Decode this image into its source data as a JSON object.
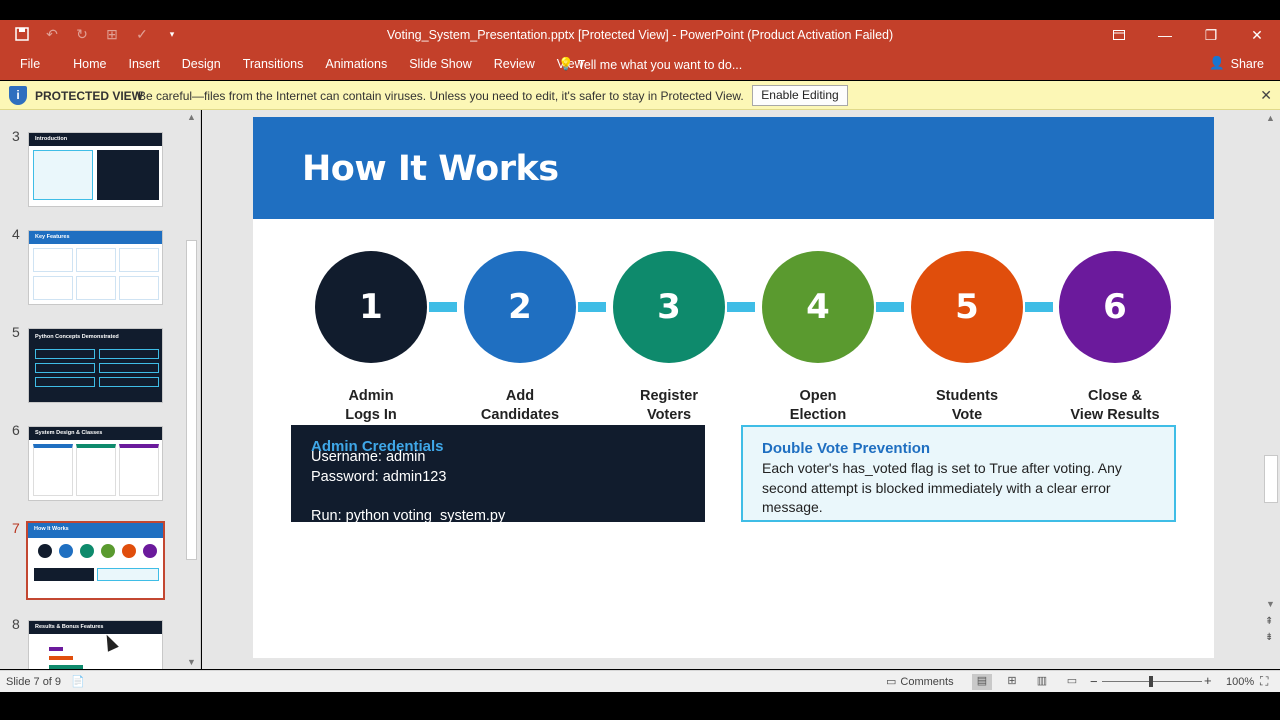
{
  "window": {
    "title": "Voting_System_Presentation.pptx [Protected View] - PowerPoint (Product Activation Failed)"
  },
  "qat": {
    "save_icon": "save-icon",
    "undo_icon": "undo-icon",
    "redo_icon": "redo-icon",
    "customize_icon": "chevron-down-icon"
  },
  "ribbon": {
    "tabs": [
      "File",
      "Home",
      "Insert",
      "Design",
      "Transitions",
      "Animations",
      "Slide Show",
      "Review",
      "View"
    ],
    "tell_me": "Tell me what you want to do...",
    "share": "Share"
  },
  "message_bar": {
    "label": "PROTECTED VIEW",
    "message": "Be careful—files from the Internet can contain viruses. Unless you need to edit, it's safer to stay in Protected View.",
    "button": "Enable Editing"
  },
  "thumbnails": [
    {
      "number": "3",
      "title": "Introduction"
    },
    {
      "number": "4",
      "title": "Key Features"
    },
    {
      "number": "5",
      "title": "Python Concepts Demonstrated"
    },
    {
      "number": "6",
      "title": "System Design & Classes"
    },
    {
      "number": "7",
      "title": "How It Works"
    },
    {
      "number": "8",
      "title": "Results & Bonus Features"
    }
  ],
  "slide": {
    "title": "How It Works",
    "steps": [
      {
        "number": "1",
        "line1": "Admin",
        "line2": "Logs In",
        "color": "#111c2d"
      },
      {
        "number": "2",
        "line1": "Add",
        "line2": "Candidates",
        "color": "#1f6fc1"
      },
      {
        "number": "3",
        "line1": "Register",
        "line2": "Voters",
        "color": "#0e8a6c"
      },
      {
        "number": "4",
        "line1": "Open",
        "line2": "Election",
        "color": "#5a9a2f"
      },
      {
        "number": "5",
        "line1": "Students",
        "line2": "Vote",
        "color": "#e04e0c"
      },
      {
        "number": "6",
        "line1": "Close &",
        "line2": "View Results",
        "color": "#6b1a9c"
      }
    ],
    "credentials": {
      "title": "Admin Credentials",
      "username": "Username: admin",
      "password": "Password: admin123",
      "run": "Run: python voting_system.py"
    },
    "double_vote": {
      "title": "Double Vote Prevention",
      "text": "Each voter's has_voted flag is set to True after voting. Any second attempt is blocked immediately with a clear error message."
    }
  },
  "status": {
    "slide": "Slide 7 of 9",
    "comments": "Comments",
    "zoom": "100%"
  },
  "colors": {
    "accent": "#c3402a",
    "connector": "#3fbde6"
  }
}
